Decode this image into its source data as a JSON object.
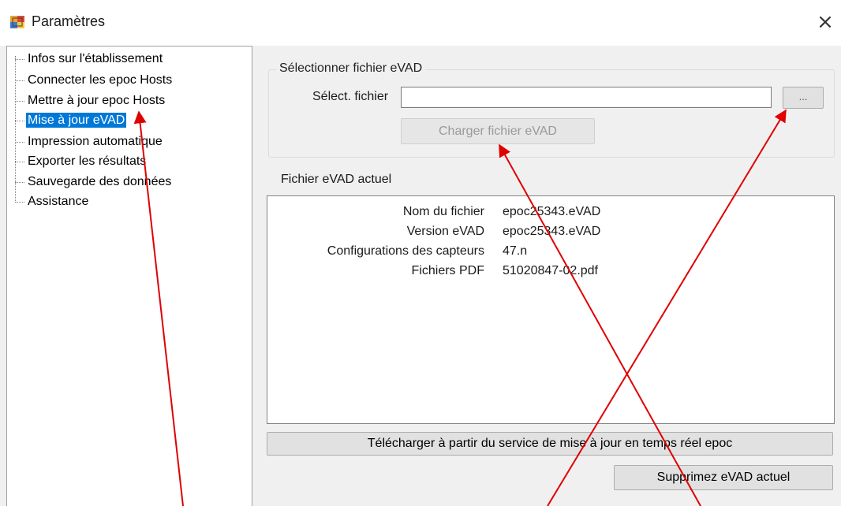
{
  "window": {
    "title": "Paramètres",
    "close_glyph": "×",
    "icon": "settings-app-icon"
  },
  "tree": {
    "items": [
      {
        "label": "Infos sur l'établissement",
        "selected": false
      },
      {
        "label": "Connecter les epoc Hosts",
        "selected": false
      },
      {
        "label": "Mettre à jour epoc Hosts",
        "selected": false
      },
      {
        "label": "Mise à jour eVAD",
        "selected": true
      },
      {
        "label": "Impression automatique",
        "selected": false
      },
      {
        "label": "Exporter les résultats",
        "selected": false
      },
      {
        "label": "Sauvegarde des données",
        "selected": false
      },
      {
        "label": "Assistance",
        "selected": false
      }
    ]
  },
  "select_group": {
    "legend": "Sélectionner fichier eVAD",
    "file_label": "Sélect. fichier",
    "file_value": "",
    "browse_label": "...",
    "load_label": "Charger fichier eVAD"
  },
  "current": {
    "legend": "Fichier eVAD actuel",
    "rows": [
      {
        "label": "Nom du fichier",
        "value": "epoc25343.eVAD"
      },
      {
        "label": "Version eVAD",
        "value": "epoc25343.eVAD"
      },
      {
        "label": "Configurations des capteurs",
        "value": "47.n"
      },
      {
        "label": "Fichiers PDF",
        "value": "51020847-02.pdf"
      }
    ]
  },
  "actions": {
    "download_label": "Télécharger à partir du service de mise à jour en temps réel epoc",
    "delete_label": "Supprimez eVAD actuel"
  },
  "colors": {
    "selection": "#0078d7",
    "annotation_arrow": "#e00000",
    "dialog_bg": "#f0f0f0"
  }
}
